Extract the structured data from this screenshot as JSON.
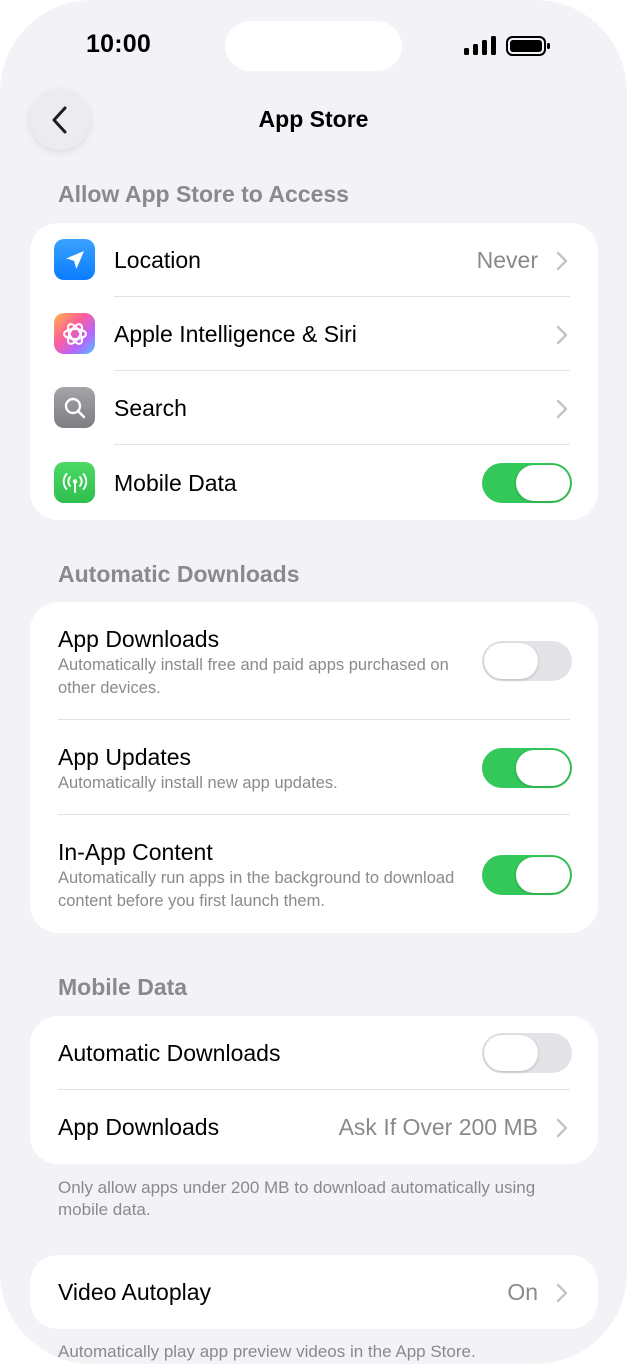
{
  "status_bar": {
    "time": "10:00"
  },
  "nav": {
    "title": "App Store"
  },
  "access_section": {
    "header": "Allow App Store to Access",
    "items": [
      {
        "label": "Location",
        "value": "Never",
        "icon": "location-arrow-icon",
        "icon_color": "#1a8cff"
      },
      {
        "label": "Apple Intelligence & Siri",
        "icon": "apple-intelligence-icon"
      },
      {
        "label": "Search",
        "icon": "search-icon",
        "icon_color": "#8e8e93"
      },
      {
        "label": "Mobile Data",
        "icon": "antenna-icon",
        "icon_color": "#34c759",
        "toggle": true
      }
    ]
  },
  "auto_downloads": {
    "header": "Automatic Downloads",
    "items": [
      {
        "title": "App Downloads",
        "desc": "Automatically install free and paid apps purchased on other devices.",
        "toggle": false
      },
      {
        "title": "App Updates",
        "desc": "Automatically install new app updates.",
        "toggle": true
      },
      {
        "title": "In-App Content",
        "desc": "Automatically run apps in the background to download content before you first launch them.",
        "toggle": true
      }
    ]
  },
  "mobile_data": {
    "header": "Mobile Data",
    "items": [
      {
        "label": "Automatic Downloads",
        "toggle": false
      },
      {
        "label": "App Downloads",
        "value": "Ask If Over 200 MB"
      }
    ],
    "footer": "Only allow apps under 200 MB to download automatically using mobile data."
  },
  "video": {
    "label": "Video Autoplay",
    "value": "On",
    "footer": "Automatically play app preview videos in the App Store."
  },
  "colors": {
    "toggle_on": "#34c759",
    "toggle_off": "#e3e3e8",
    "background": "#f2f2f7",
    "secondary_text": "#8a8a8e"
  }
}
